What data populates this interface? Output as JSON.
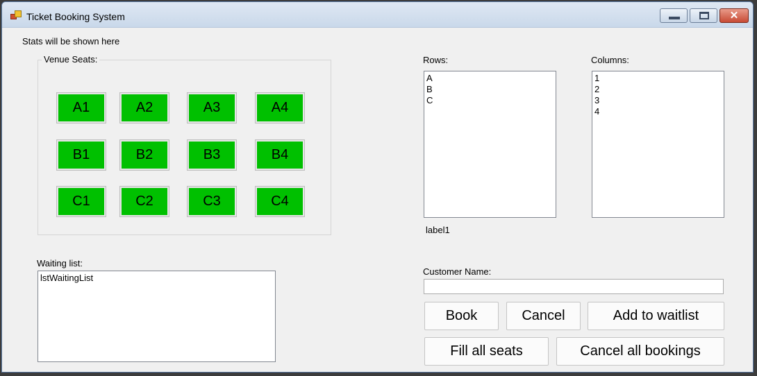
{
  "window": {
    "title": "Ticket Booking System"
  },
  "stats": {
    "text": "Stats will be shown here"
  },
  "venue": {
    "label": "Venue Seats:",
    "seat_color": "#00c000",
    "seats": [
      "A1",
      "A2",
      "A3",
      "A4",
      "B1",
      "B2",
      "B3",
      "B4",
      "C1",
      "C2",
      "C3",
      "C4"
    ]
  },
  "rows": {
    "label": "Rows:",
    "items": [
      "A",
      "B",
      "C"
    ]
  },
  "columns": {
    "label": "Columns:",
    "items": [
      "1",
      "2",
      "3",
      "4"
    ]
  },
  "label1": "label1",
  "waiting": {
    "label": "Waiting list:",
    "items": [
      "lstWaitingList"
    ]
  },
  "customer": {
    "label": "Customer Name:",
    "value": ""
  },
  "buttons": {
    "book": "Book",
    "cancel": "Cancel",
    "add_waitlist": "Add to waitlist",
    "fill_all": "Fill all seats",
    "cancel_all": "Cancel all bookings"
  }
}
